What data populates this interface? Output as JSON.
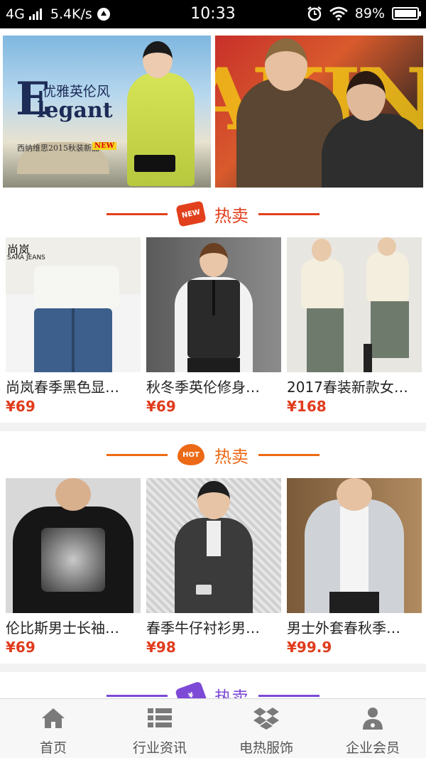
{
  "status_bar": {
    "network": "4G",
    "speed": "5.4K/s",
    "time": "10:33",
    "battery": "89%",
    "battery_level": 0.89
  },
  "banner": {
    "left": {
      "cn_title": "优雅英伦风",
      "big_letter": "E",
      "en_title": "legant",
      "subtitle": "西纳维思2015秋装新品",
      "new_tag": "NEW"
    },
    "right": {
      "bg_text": "AKIN"
    }
  },
  "sections": [
    {
      "badge": "NEW",
      "title": "热卖",
      "products": [
        {
          "name": "尚岚春季黑色显…",
          "price": "¥69",
          "brand": "尚岚",
          "brand_sub": "SARA JEANS"
        },
        {
          "name": "秋冬季英伦修身…",
          "price": "¥69"
        },
        {
          "name": "2017春装新款女…",
          "price": "¥168"
        }
      ]
    },
    {
      "badge": "HOT",
      "title": "热卖",
      "products": [
        {
          "name": "伦比斯男士长袖…",
          "price": "¥69"
        },
        {
          "name": "春季牛仔衬衫男…",
          "price": "¥98"
        },
        {
          "name": "男士外套春秋季…",
          "price": "¥99.9"
        }
      ]
    },
    {
      "badge": "¥",
      "title": "热卖"
    }
  ],
  "tabbar": [
    {
      "label": "首页",
      "icon": "home-icon"
    },
    {
      "label": "行业资讯",
      "icon": "list-icon"
    },
    {
      "label": "电热服饰",
      "icon": "dropbox-icon"
    },
    {
      "label": "企业会员",
      "icon": "member-icon"
    }
  ]
}
